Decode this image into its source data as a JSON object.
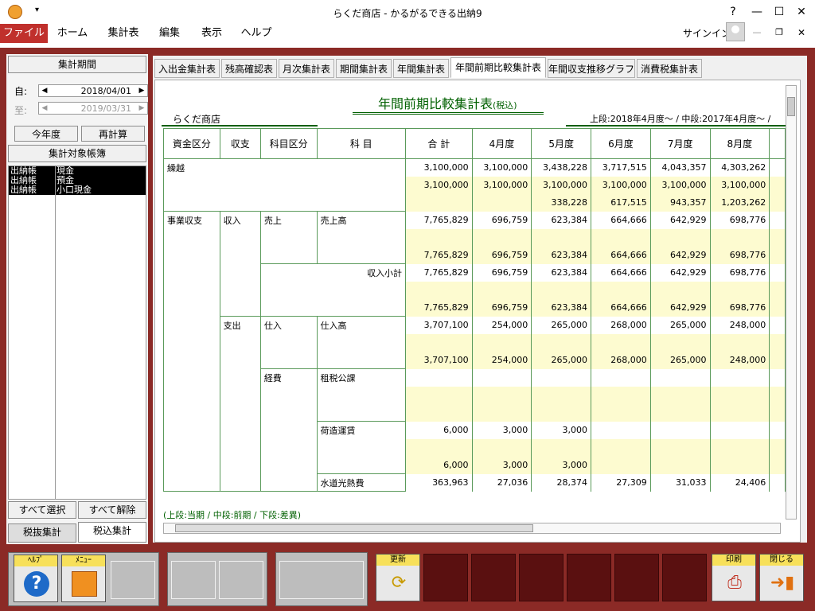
{
  "window": {
    "title": "らくだ商店 - かるがるできる出納9",
    "help": "?",
    "minimize": "—",
    "maximize": "☐",
    "close": "✕",
    "qat": "▾"
  },
  "menu": {
    "items": [
      "ファイル",
      "ホーム",
      "集計表",
      "編集",
      "表示",
      "ヘルプ"
    ],
    "signin": "サインイン"
  },
  "left": {
    "period_button": "集計期間",
    "from_label": "自:",
    "to_label": "至:",
    "from_date": "2018/04/01",
    "to_date": "2019/03/31",
    "this_year": "今年度",
    "recalc": "再計算",
    "books_button": "集計対象帳簿",
    "books": [
      [
        "出納帳",
        "現金"
      ],
      [
        "出納帳",
        "預金"
      ],
      [
        "出納帳",
        "小口現金"
      ]
    ],
    "select_all": "すべて選択",
    "deselect_all": "すべて解除",
    "tax_excluded": "税抜集計",
    "tax_included": "税込集計"
  },
  "tabs": [
    "入出金集計表",
    "残高確認表",
    "月次集計表",
    "期間集計表",
    "年間集計表",
    "年間前期比較集計表",
    "年間収支推移グラフ",
    "消費税集計表"
  ],
  "report": {
    "title": "年間前期比較集計表",
    "title_suffix": "(税込)",
    "company": "らくだ商店",
    "period": "上段:2018年4月度～ / 中段:2017年4月度～ /",
    "headers": [
      "資金区分",
      "収支",
      "科目区分",
      "科 目",
      "合 計",
      "4月度",
      "5月度",
      "6月度",
      "7月度",
      "8月度"
    ],
    "footnote": "(上段:当期 / 中段:前期 / 下段:差異)",
    "rows": {
      "kurikoshi": {
        "label": "繰越",
        "r1": [
          "3,100,000",
          "3,100,000",
          "3,438,228",
          "3,717,515",
          "4,043,357",
          "4,303,262"
        ],
        "r2": [
          "3,100,000",
          "3,100,000",
          "3,100,000",
          "3,100,000",
          "3,100,000",
          "3,100,000"
        ],
        "r3": [
          "",
          "",
          "338,228",
          "617,515",
          "943,357",
          "1,203,262"
        ]
      },
      "jigyo": "事業収支",
      "shunyu": "収入",
      "uriage_k": "売上",
      "uriage": {
        "label": "売上高",
        "r1": [
          "7,765,829",
          "696,759",
          "623,384",
          "664,666",
          "642,929",
          "698,776"
        ],
        "r2": [
          "",
          "",
          "",
          "",
          "",
          ""
        ],
        "r3": [
          "7,765,829",
          "696,759",
          "623,384",
          "664,666",
          "642,929",
          "698,776"
        ]
      },
      "shunyu_sub": {
        "label": "収入小計",
        "r1": [
          "7,765,829",
          "696,759",
          "623,384",
          "664,666",
          "642,929",
          "698,776"
        ],
        "r2": [
          "",
          "",
          "",
          "",
          "",
          ""
        ],
        "r3": [
          "7,765,829",
          "696,759",
          "623,384",
          "664,666",
          "642,929",
          "698,776"
        ]
      },
      "shishutsu": "支出",
      "shiire_k": "仕入",
      "shiire": {
        "label": "仕入高",
        "r1": [
          "3,707,100",
          "254,000",
          "265,000",
          "268,000",
          "265,000",
          "248,000"
        ],
        "r2": [
          "",
          "",
          "",
          "",
          "",
          ""
        ],
        "r3": [
          "3,707,100",
          "254,000",
          "265,000",
          "268,000",
          "265,000",
          "248,000"
        ]
      },
      "keihi_k": "経費",
      "sozei": {
        "label": "租税公課",
        "r1": [
          "",
          "",
          "",
          "",
          "",
          ""
        ],
        "r2": [
          "",
          "",
          "",
          "",
          "",
          ""
        ],
        "r3": [
          "",
          "",
          "",
          "",
          "",
          ""
        ]
      },
      "nizukuri": {
        "label": "荷造運賃",
        "r1": [
          "6,000",
          "3,000",
          "3,000",
          "",
          "",
          ""
        ],
        "r2": [
          "",
          "",
          "",
          "",
          "",
          ""
        ],
        "r3": [
          "6,000",
          "3,000",
          "3,000",
          "",
          "",
          ""
        ]
      },
      "suido": {
        "label": "水道光熱費",
        "r1": [
          "363,963",
          "27,036",
          "28,374",
          "27,309",
          "31,033",
          "24,406"
        ]
      }
    }
  },
  "toolbar": {
    "help": "ﾍﾙﾌﾟ",
    "menu": "ﾒﾆｭｰ",
    "update": "更新",
    "print": "印刷",
    "close": "閉じる"
  }
}
